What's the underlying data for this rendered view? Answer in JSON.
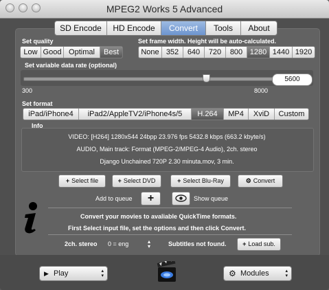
{
  "window": {
    "title": "MPEG2 Works 5 Advanced"
  },
  "tabs": [
    "SD Encode",
    "HD Encode",
    "Convert",
    "Tools",
    "About"
  ],
  "selected_tab": "Convert",
  "quality": {
    "label": "Set quality",
    "options": [
      "Low",
      "Good",
      "Optimal",
      "Best"
    ],
    "selected": "Best"
  },
  "frame_width": {
    "label": "Set frame width. Height will be auto-calculated.",
    "options": [
      "None",
      "352",
      "640",
      "720",
      "800",
      "1280",
      "1440",
      "1920"
    ],
    "selected": "1280"
  },
  "data_rate": {
    "label": "Set variable data rate (optional)",
    "min": "300",
    "max": "8000",
    "value": "5600",
    "slider_fraction": 0.685
  },
  "format": {
    "label": "Set format",
    "options": [
      "iPad/iPhone4",
      "iPad2/AppleTV2/iPhone4s/5",
      "H.264",
      "MP4",
      "XviD",
      "Custom"
    ],
    "selected": "H.264"
  },
  "info": {
    "label": "Info",
    "line1": "VIDEO:  [H264]  1280x544  24bpp  23.976 fps  5432.8 kbps (663.2 kbyte/s)",
    "line2": "AUDIO, Main track:  Format (MPEG-2/MPEG-4 Audio), 2ch. stereo",
    "line3": "Django Unchained 720P 2.30 minuta.mov, 3 min."
  },
  "buttons": {
    "select_file": "Select file",
    "select_dvd": "Select DVD",
    "select_bluray": "Select Blu-Ray",
    "convert": "Convert"
  },
  "queue": {
    "add_label": "Add to queue",
    "show_label": "Show queue"
  },
  "message": {
    "line1": "Convert your movies to avaliable QuickTime formats.",
    "line2": "First Select input file, set the options and then click Convert."
  },
  "audio": {
    "channel": "2ch. stereo",
    "track": "0 = eng"
  },
  "subtitles": {
    "status": "Subtitles not found.",
    "load_button": "Load sub."
  },
  "bottom": {
    "play": "Play",
    "modules": "Modules"
  }
}
